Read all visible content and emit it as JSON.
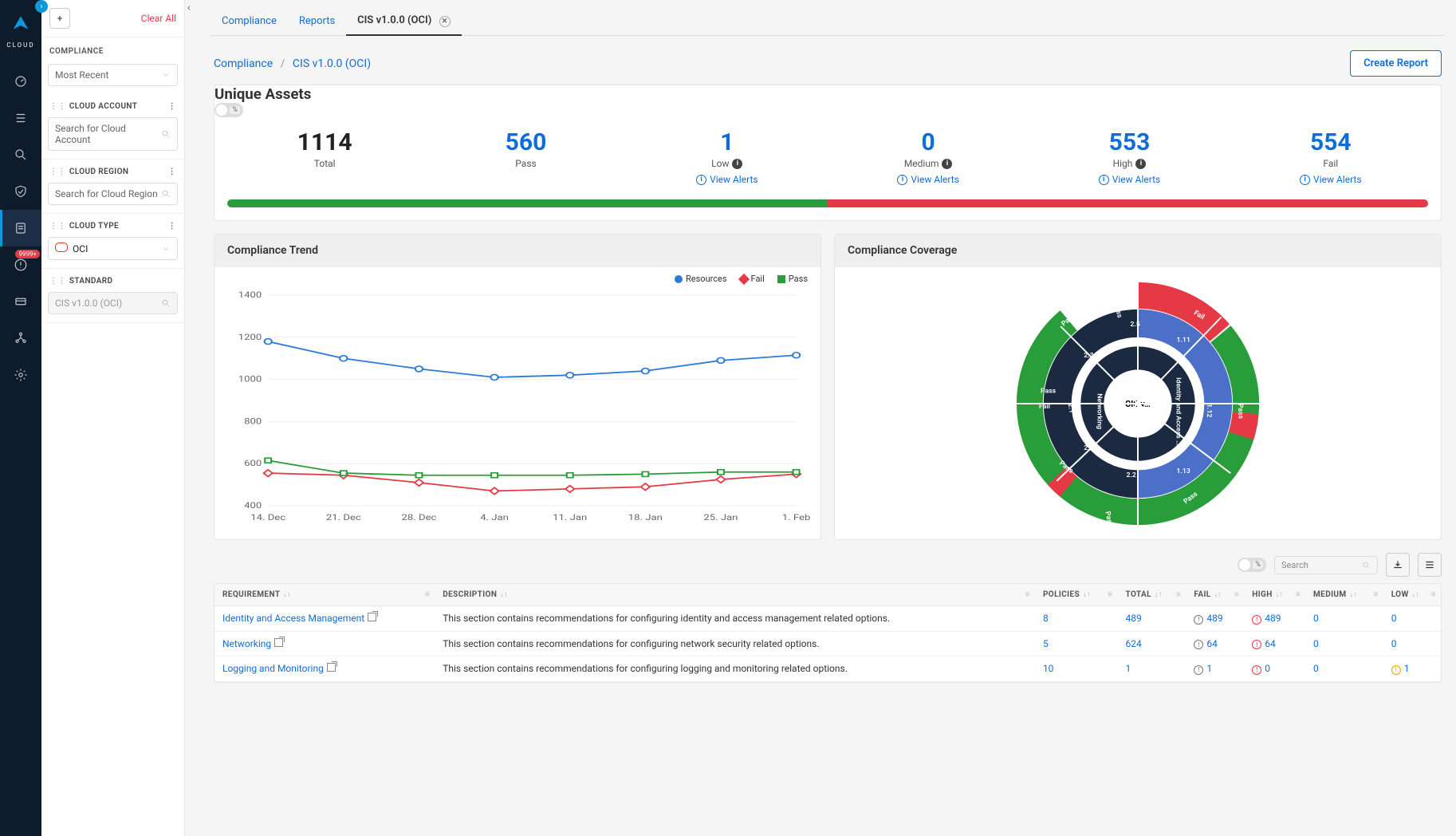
{
  "brand": "CLOUD",
  "rail_badge": "9999+",
  "sidebar": {
    "clear": "Clear All",
    "compliance_hd": "COMPLIANCE",
    "sort_select": "Most Recent",
    "blocks": [
      {
        "title": "CLOUD ACCOUNT",
        "placeholder": "Search for Cloud Account"
      },
      {
        "title": "CLOUD REGION",
        "placeholder": "Search for Cloud Region"
      },
      {
        "title": "CLOUD TYPE",
        "value": "OCI"
      },
      {
        "title": "STANDARD",
        "value": "CIS v1.0.0 (OCI)"
      }
    ]
  },
  "tabs": [
    {
      "label": "Compliance",
      "active": false
    },
    {
      "label": "Reports",
      "active": false
    },
    {
      "label": "CIS v1.0.0 (OCI)",
      "active": true,
      "closable": true
    }
  ],
  "crumb": {
    "root": "Compliance",
    "leaf": "CIS v1.0.0 (OCI)"
  },
  "create_btn": "Create Report",
  "assets": {
    "heading": "Unique Assets",
    "total": {
      "value": "1114",
      "label": "Total"
    },
    "pass": {
      "value": "560",
      "label": "Pass"
    },
    "low": {
      "value": "1",
      "label": "Low",
      "view": "View Alerts"
    },
    "medium": {
      "value": "0",
      "label": "Medium",
      "view": "View Alerts"
    },
    "high": {
      "value": "553",
      "label": "High",
      "view": "View Alerts"
    },
    "fail": {
      "value": "554",
      "label": "Fail",
      "view": "View Alerts"
    },
    "bar_pass_pct": 50,
    "bar_fail_pct": 50
  },
  "trend_title": "Compliance Trend",
  "coverage_title": "Compliance Coverage",
  "legend": {
    "resources": "Resources",
    "fail": "Fail",
    "pass": "Pass"
  },
  "coverage_center": "CIS v…",
  "coverage_labels": {
    "pass": "Pass",
    "fail": "Fail",
    "s11": "1.11",
    "s12": "1.12",
    "s13": "1.13",
    "iam": "Identity and Access …",
    "net": "Networking",
    "s21": "2.1",
    "s22": "2.2",
    "s23": "2.3",
    "s24": "2.4",
    "s25": "2.5"
  },
  "table": {
    "search_ph": "Search",
    "cols": [
      "REQUIREMENT",
      "DESCRIPTION",
      "POLICIES",
      "TOTAL",
      "FAIL",
      "HIGH",
      "MEDIUM",
      "LOW"
    ],
    "rows": [
      {
        "req": "Identity and Access Management",
        "desc": "This section contains recommendations for configuring identity and access management related options.",
        "policies": "8",
        "total": "489",
        "fail": "489",
        "high": "489",
        "medium": "0",
        "low": "0"
      },
      {
        "req": "Networking",
        "desc": "This section contains recommendations for configuring network security related options.",
        "policies": "5",
        "total": "624",
        "fail": "64",
        "high": "64",
        "medium": "0",
        "low": "0"
      },
      {
        "req": "Logging and Monitoring",
        "desc": "This section contains recommendations for configuring logging and monitoring related options.",
        "policies": "10",
        "total": "1",
        "fail": "1",
        "high": "0",
        "medium": "0",
        "low": "1"
      }
    ]
  },
  "chart_data": {
    "type": "line",
    "xlabel": "",
    "ylabel": "",
    "x": [
      "14. Dec",
      "21. Dec",
      "28. Dec",
      "4. Jan",
      "11. Jan",
      "18. Jan",
      "25. Jan",
      "1. Feb"
    ],
    "yticks": [
      400,
      600,
      800,
      1000,
      1200,
      1400
    ],
    "ylim": [
      400,
      1400
    ],
    "series": [
      {
        "name": "Resources",
        "color": "#2c7bd6",
        "values": [
          1180,
          1100,
          1050,
          1010,
          1020,
          1040,
          1090,
          1115
        ]
      },
      {
        "name": "Fail",
        "color": "#e63946",
        "values": [
          555,
          545,
          510,
          470,
          480,
          490,
          525,
          550
        ]
      },
      {
        "name": "Pass",
        "color": "#2a9d3b",
        "values": [
          615,
          555,
          545,
          545,
          545,
          550,
          560,
          560
        ]
      }
    ]
  }
}
